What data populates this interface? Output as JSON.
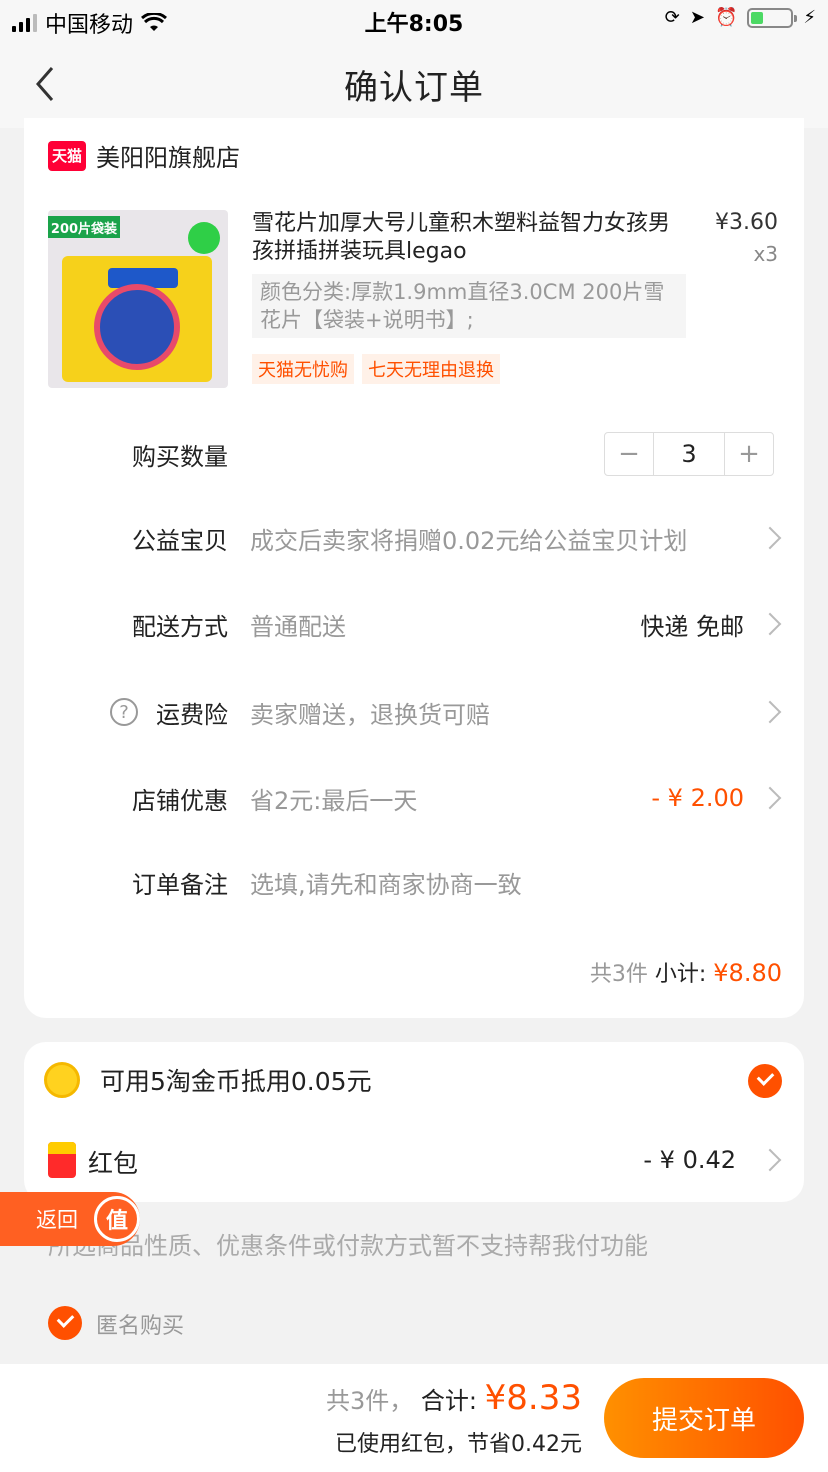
{
  "status_bar": {
    "carrier": "中国移动",
    "time": "上午8:05"
  },
  "nav": {
    "title": "确认订单"
  },
  "shop": {
    "badge": "天猫",
    "name": "美阳阳旗舰店"
  },
  "product": {
    "image_banner": "200片袋装",
    "title": "雪花片加厚大号儿童积木塑料益智力女孩男孩拼插拼装玩具legao",
    "price": "¥3.60",
    "quantity": "x3",
    "spec": "颜色分类:厚款1.9mm直径3.0CM 200片雪花片【袋装+说明书】;",
    "tags": [
      "天猫无忧购",
      "七天无理由退换"
    ]
  },
  "rows": {
    "qty_label": "购买数量",
    "qty_value": "3",
    "qty_minus": "−",
    "qty_plus": "+",
    "charity_label": "公益宝贝",
    "charity_text": "成交后卖家将捐赠0.02元给公益宝贝计划",
    "delivery_label": "配送方式",
    "delivery_text": "普通配送",
    "delivery_value": "快递 免邮",
    "insurance_icon": "?",
    "insurance_label": "运费险",
    "insurance_text": "卖家赠送，退换货可赔",
    "discount_label": "店铺优惠",
    "discount_text": "省2元:最后一天",
    "discount_value": "- ¥ 2.00",
    "note_label": "订单备注",
    "note_placeholder": "选填,请先和商家协商一致"
  },
  "subtotal": {
    "count": "共3件",
    "label": "小计:",
    "amount": "¥8.80"
  },
  "coins": {
    "text": "可用5淘金币抵用0.05元"
  },
  "red_packet": {
    "label": "红包",
    "value": "- ¥ 0.42"
  },
  "notice": "所选商品性质、优惠条件或付款方式暂不支持帮我付功能",
  "return_btn": {
    "label": "返回",
    "badge": "值"
  },
  "anonymous": {
    "label": "匿名购买"
  },
  "bottom": {
    "count": "共3件，",
    "total_label": "合计:",
    "total_amount": "¥8.33",
    "savings": "已使用红包，节省0.42元",
    "submit": "提交订单"
  }
}
